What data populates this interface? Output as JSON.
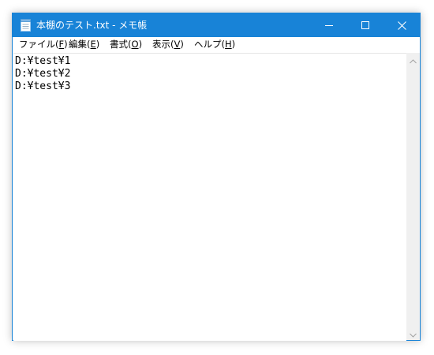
{
  "window": {
    "title": "本棚のテスト.txt - メモ帳",
    "accent_color": "#1883d7",
    "app_icon": "notepad-icon",
    "controls": {
      "minimize_icon": "minimize-icon",
      "maximize_icon": "maximize-icon",
      "close_icon": "close-icon"
    }
  },
  "menu": {
    "items": [
      {
        "label": "ファイル(",
        "mnemonic": "F",
        "suffix": ")"
      },
      {
        "label": "編集(",
        "mnemonic": "E",
        "suffix": ")"
      },
      {
        "label": "書式(",
        "mnemonic": "O",
        "suffix": ")"
      },
      {
        "label": "表示(",
        "mnemonic": "V",
        "suffix": ")"
      },
      {
        "label": "ヘルプ(",
        "mnemonic": "H",
        "suffix": ")"
      }
    ]
  },
  "editor": {
    "lines": [
      "D:¥test¥1",
      "D:¥test¥2",
      "D:¥test¥3"
    ]
  },
  "scrollbar": {
    "up_icon": "scroll-up-arrow-icon",
    "down_icon": "scroll-down-arrow-icon"
  }
}
